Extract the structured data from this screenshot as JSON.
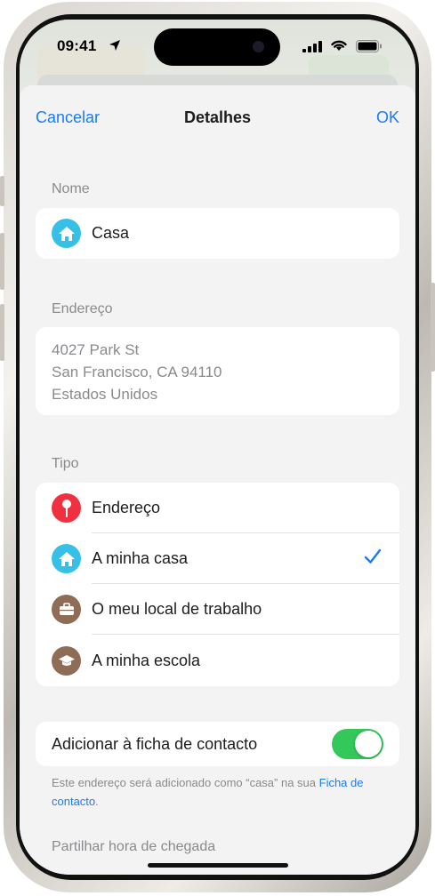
{
  "status_bar": {
    "time": "09:41"
  },
  "nav": {
    "cancel": "Cancelar",
    "title": "Detalhes",
    "ok": "OK"
  },
  "name_section": {
    "label": "Nome",
    "value": "Casa",
    "icon": "house-icon"
  },
  "address_section": {
    "label": "Endereço",
    "lines": [
      "4027 Park St",
      "San Francisco, CA  94110",
      "Estados Unidos"
    ]
  },
  "type_section": {
    "label": "Tipo",
    "options": [
      {
        "label": "Endereço",
        "icon": "pin-icon",
        "color": "#f0303f",
        "selected": false
      },
      {
        "label": "A minha casa",
        "icon": "house-icon",
        "color": "#36c0e6",
        "selected": true
      },
      {
        "label": "O meu local de trabalho",
        "icon": "briefcase-icon",
        "color": "#8e6c55",
        "selected": false
      },
      {
        "label": "A minha escola",
        "icon": "graduation-cap-icon",
        "color": "#8e6c55",
        "selected": false
      }
    ]
  },
  "contact_toggle": {
    "label": "Adicionar à ficha de contacto",
    "on": true
  },
  "footnote": {
    "text_before": "Este endereço será adicionado como “casa” na sua ",
    "link": "Ficha de contacto",
    "text_after": "."
  },
  "share_section": {
    "label": "Partilhar hora de chegada"
  },
  "colors": {
    "accent": "#1a7cf5",
    "toggle_on": "#34c759"
  }
}
